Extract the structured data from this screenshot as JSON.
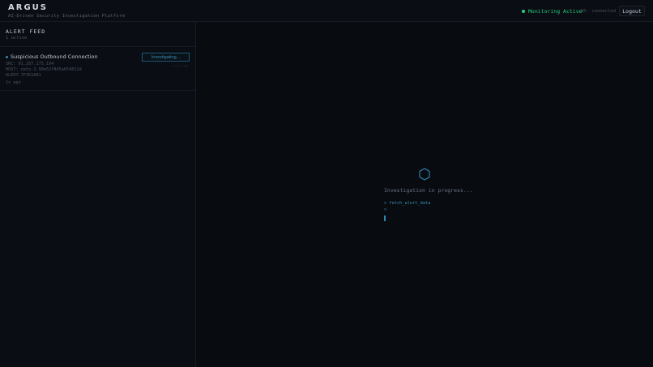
{
  "header": {
    "brand": "ARGUS",
    "subtitle": "AI-Driven Security Investigation Platform",
    "monitoring_label": "Monitoring Active",
    "ws_status": "WS: connected",
    "logout_label": "Logout"
  },
  "sidebar": {
    "title": "ALERT FEED",
    "count": "1 active",
    "alerts": [
      {
        "title": "Suspicious Outbound Connection",
        "src": "SRC: 91.207.175.194",
        "host": "HOST: nats-1-90e52f8b5a654812d",
        "id": "ALERT-7F3D1A81",
        "time": "1s ago",
        "status": "Investigating...",
        "status_sub": "running"
      }
    ]
  },
  "main": {
    "icon": "hexagon-icon",
    "progress_text": "Investigation in progress...",
    "terminal": [
      "> fetch_alert_data",
      ">"
    ]
  },
  "colors": {
    "accent": "#2f86b5",
    "success": "#26d07c",
    "background": "#090c12"
  }
}
